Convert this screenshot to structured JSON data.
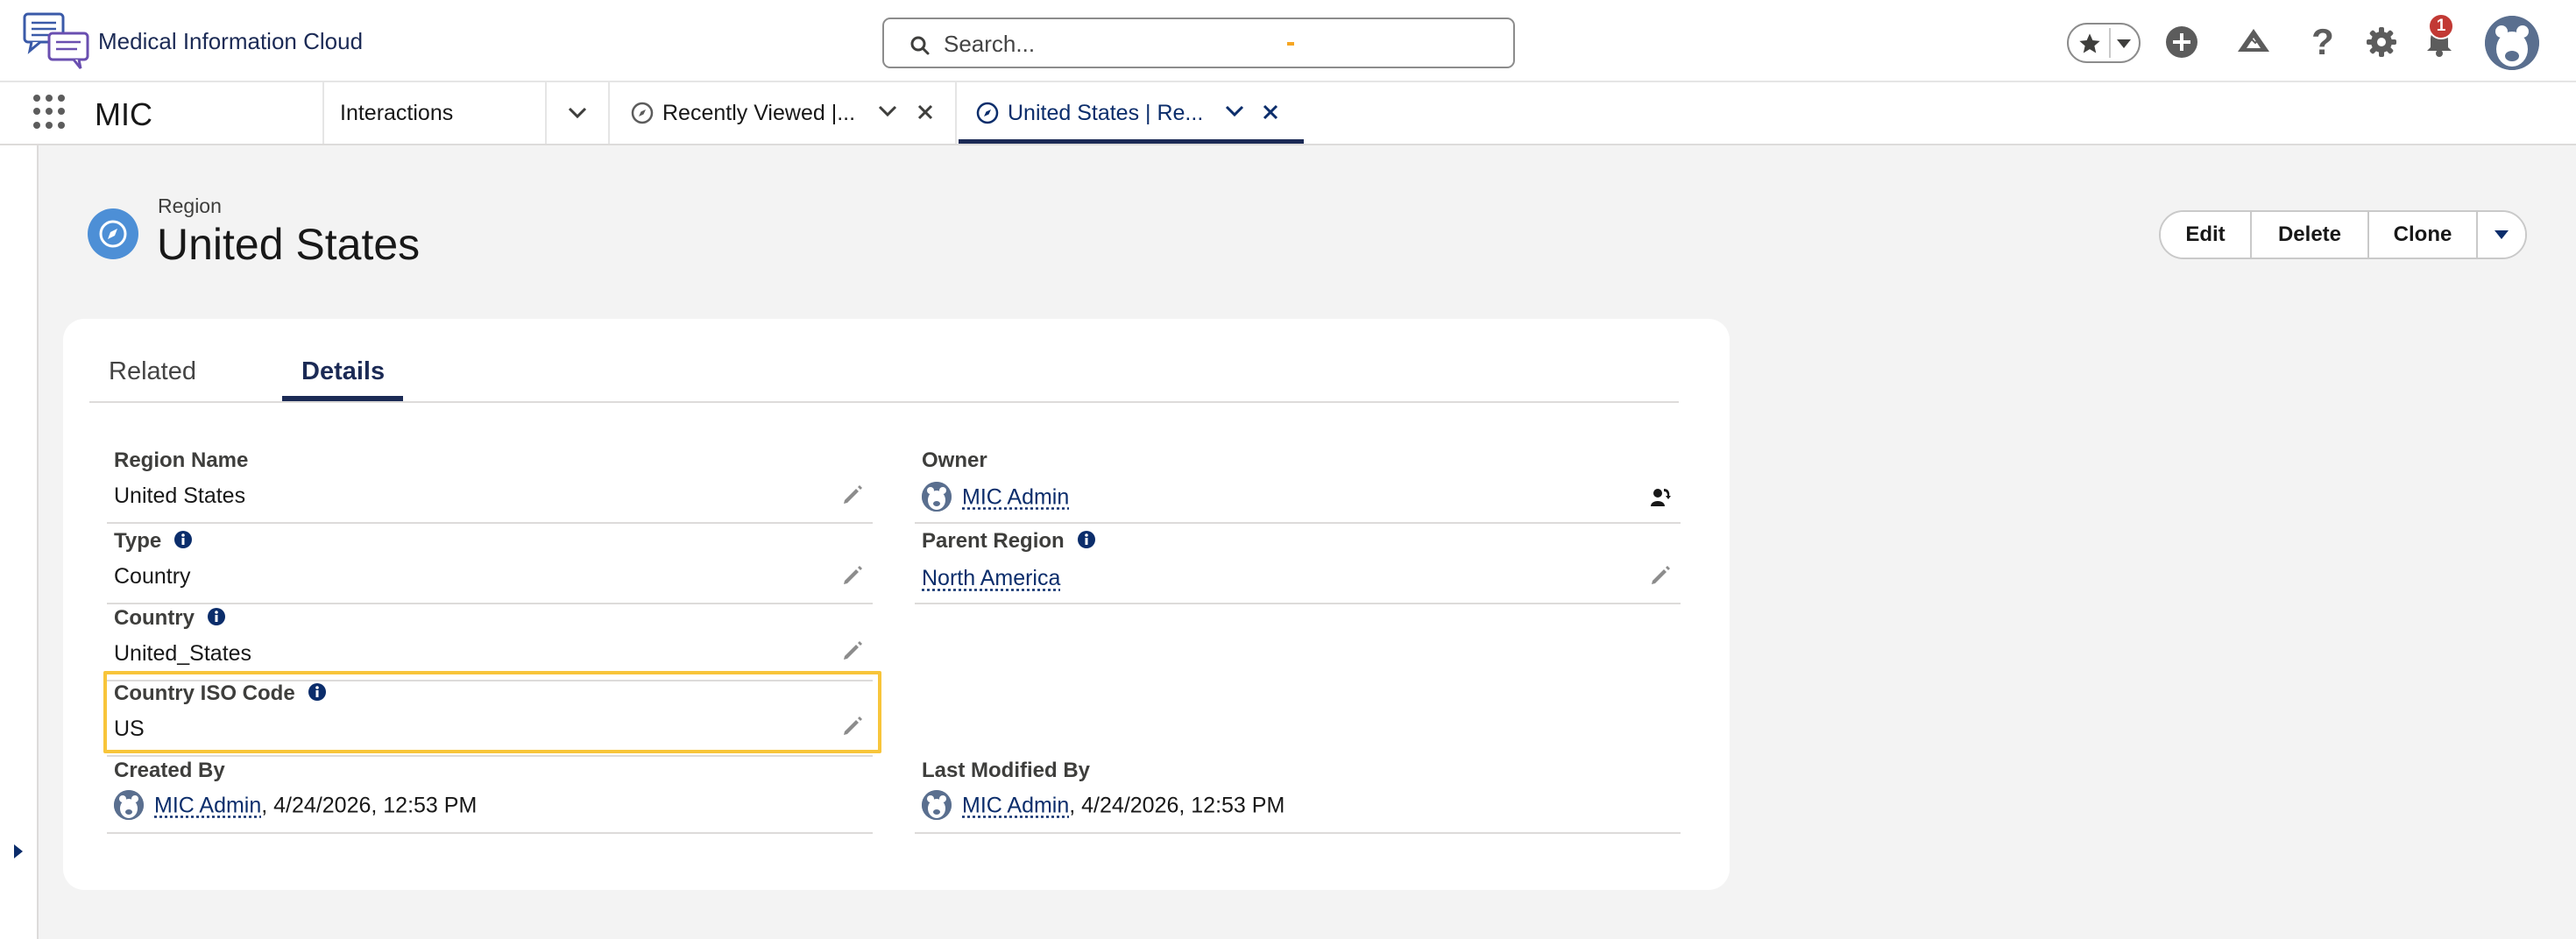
{
  "header": {
    "logo_text": "Medical Information Cloud",
    "search_placeholder": "Search...",
    "notification_count": "1"
  },
  "nav": {
    "app_name": "MIC",
    "items": [
      {
        "label": "Interactions"
      }
    ],
    "tabs": [
      {
        "label": "Recently Viewed |..."
      },
      {
        "label": "United States | Re..."
      }
    ]
  },
  "record": {
    "type": "Region",
    "title": "United States",
    "actions": {
      "edit": "Edit",
      "delete": "Delete",
      "clone": "Clone"
    }
  },
  "tabs": {
    "related": "Related",
    "details": "Details"
  },
  "fields": {
    "region_name": {
      "label": "Region Name",
      "value": "United States"
    },
    "owner": {
      "label": "Owner",
      "value": "MIC Admin"
    },
    "type": {
      "label": "Type",
      "value": "Country"
    },
    "parent_region": {
      "label": "Parent Region",
      "value": "North America"
    },
    "country": {
      "label": "Country",
      "value": "United_States"
    },
    "country_iso": {
      "label": "Country ISO Code",
      "value": "US"
    },
    "created_by": {
      "label": "Created By",
      "user": "MIC Admin",
      "date": ", 4/24/2026, 12:53 PM"
    },
    "last_modified_by": {
      "label": "Last Modified By",
      "user": "MIC Admin",
      "date": ", 4/24/2026, 12:53 PM"
    }
  },
  "colors": {
    "brand_navy": "#1b2a55",
    "highlight": "#f8c53a",
    "record_icon": "#4d8fd6",
    "badge": "#c23934"
  }
}
